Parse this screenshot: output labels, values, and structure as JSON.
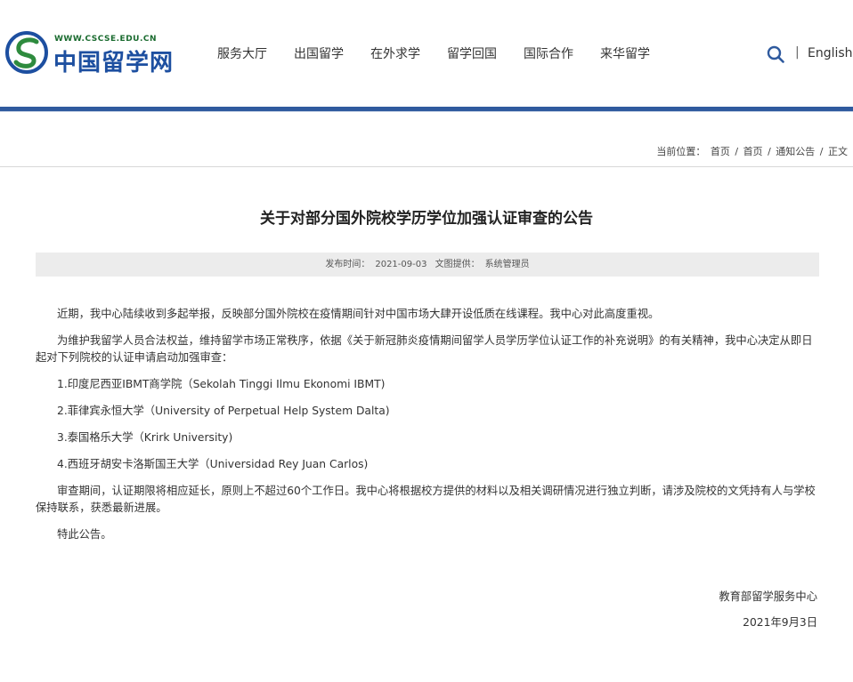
{
  "header": {
    "logo_url": "WWW.CSCSE.EDU.CN",
    "logo_name": "中国留学网",
    "nav": [
      "服务大厅",
      "出国留学",
      "在外求学",
      "留学回国",
      "国际合作",
      "来华留学"
    ],
    "divider": "|",
    "language": "English"
  },
  "breadcrumb": {
    "prefix": "当前位置：",
    "items": [
      "首页",
      "首页",
      "通知公告",
      "正文"
    ],
    "separator": "/"
  },
  "article": {
    "title": "关于对部分国外院校学历学位加强认证审查的公告",
    "publish_label": "发布时间：",
    "publish_date": "2021-09-03",
    "provider_label": "文图提供：",
    "provider": "系统管理员",
    "paragraphs": [
      "近期，我中心陆续收到多起举报，反映部分国外院校在疫情期间针对中国市场大肆开设低质在线课程。我中心对此高度重视。",
      "为维护我留学人员合法权益，维持留学市场正常秩序，依据《关于新冠肺炎疫情期间留学人员学历学位认证工作的补充说明》的有关精神，我中心决定从即日起对下列院校的认证申请启动加强审查："
    ],
    "items": [
      "1.印度尼西亚IBMT商学院（Sekolah Tinggi Ilmu Ekonomi IBMT)",
      "2.菲律宾永恒大学（University of Perpetual Help System Dalta)",
      "3.泰国格乐大学（Krirk University)",
      "4.西班牙胡安卡洛斯国王大学（Universidad Rey Juan Carlos)"
    ],
    "closing": "审查期间，认证期限将相应延长，原则上不超过60个工作日。我中心将根据校方提供的材料以及相关调研情况进行独立判断，请涉及院校的文凭持有人与学校保持联系，获悉最新进展。",
    "notice": "特此公告。",
    "signature": "教育部留学服务中心",
    "date": "2021年9月3日"
  },
  "colors": {
    "brand_blue": "#2f5a9e",
    "logo_green": "#1a6b2f",
    "logo_blue": "#1d4fa0",
    "meta_bg": "#ececec"
  },
  "icons": [
    "logo-icon",
    "search-icon"
  ]
}
